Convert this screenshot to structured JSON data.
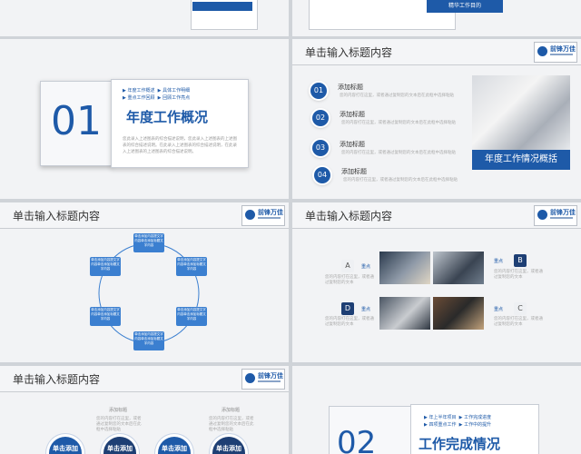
{
  "top_right": {
    "button_label": "精华工作目的"
  },
  "logo_text": "前锋万佳",
  "slide1": {
    "number": "01",
    "tags_row1": [
      "年度工作概述",
      "具体工作明细"
    ],
    "tags_row2": [
      "重点工作回顾",
      "回顾工作亮点"
    ],
    "title": "年度工作概况",
    "desc": "您此录入上述图表的综合描述说明，您此录入上述图表的上述图表的综合描述说明。在此录入上述图表的综合描述说明，在此录入上述图表的上述图表的综合描述说明。"
  },
  "slide2": {
    "header": "单击输入标题内容",
    "items": [
      {
        "num": "01",
        "title": "添加标题",
        "desc": "您的内容打在这里，或者通过复制您的文本后在此框中选择粘贴"
      },
      {
        "num": "02",
        "title": "添加标题",
        "desc": "您的内容打在这里，或者通过复制您的文本后在此框中选择粘贴"
      },
      {
        "num": "03",
        "title": "添加标题",
        "desc": "您的内容打在这里，或者通过复制您的文本后在此框中选择粘贴"
      },
      {
        "num": "04",
        "title": "添加标题",
        "desc": "您的内容打在这里，或者通过复制您的文本后在此框中选择粘贴"
      }
    ],
    "caption": "年度工作情况概括"
  },
  "slide3": {
    "header": "单击输入标题内容",
    "box_text": "单击添加内容提文字内容单击添加标题文字内容"
  },
  "slide4": {
    "header": "单击输入标题内容",
    "a": "A",
    "b": "B",
    "c": "C",
    "d": "D",
    "label_a": "重点",
    "label_b": "重点",
    "label_c": "重点",
    "label_d": "重点",
    "smalltxt": "您的内容打在这里，或者通过复制您的文本"
  },
  "slide5": {
    "header": "单击输入标题内容",
    "col_title": "添加标题",
    "col_desc": "您的内容打在这里，或者通过复制您的文本后在此框中选择粘贴",
    "bubble_label": "单击添加"
  },
  "slide6": {
    "number": "02",
    "tags_row1": [
      "年上半年项目",
      "工作完成进度"
    ],
    "tags_row2": [
      "四项重点工作",
      "工作中的提升"
    ],
    "title": "工作完成情况"
  }
}
